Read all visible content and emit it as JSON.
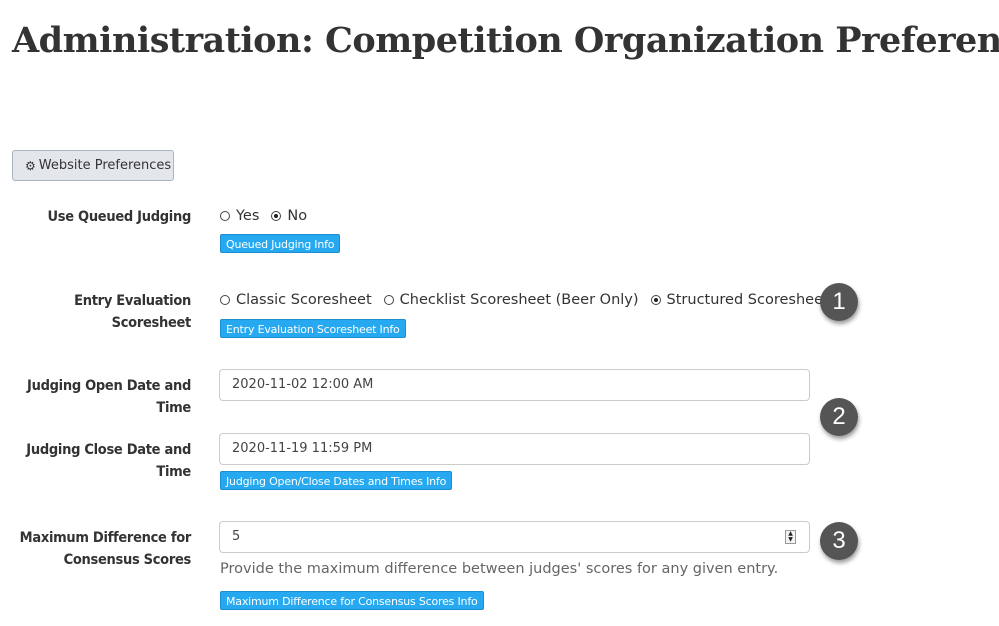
{
  "page": {
    "title": "Administration: Competition Organization Preferences"
  },
  "toolbar": {
    "website_prefs_label": "Website Preferences",
    "website_prefs_icon": "gear-icon"
  },
  "queued_judging": {
    "label": "Use Queued Judging",
    "options": [
      {
        "label": "Yes",
        "selected": false
      },
      {
        "label": "No",
        "selected": true
      }
    ],
    "info_label": "Queued Judging Info"
  },
  "scoresheet": {
    "label_line1": "Entry Evaluation",
    "label_line2": "Scoresheet",
    "options": [
      {
        "label": "Classic Scoresheet",
        "selected": false
      },
      {
        "label": "Checklist Scoresheet (Beer Only)",
        "selected": false
      },
      {
        "label": "Structured Scoresheet",
        "selected": true
      }
    ],
    "info_label": "Entry Evaluation Scoresheet Info"
  },
  "judging_open": {
    "label_line1": "Judging Open Date and",
    "label_line2": "Time",
    "value": "2020-11-02 12:00 AM"
  },
  "judging_close": {
    "label_line1": "Judging Close Date and",
    "label_line2": "Time",
    "value": "2020-11-19 11:59 PM",
    "info_label": "Judging Open/Close Dates and Times Info"
  },
  "consensus": {
    "label_line1": "Maximum Difference for",
    "label_line2": "Consensus Scores",
    "value": "5",
    "help_text": "Provide the maximum difference between judges' scores for any given entry.",
    "info_label": "Maximum Difference for Consensus Scores Info"
  },
  "callouts": [
    "1",
    "2",
    "3"
  ],
  "colors": {
    "info_button": "#27a9f1",
    "callout_badge": "#555555",
    "prefs_button_bg": "#e3e7ec"
  }
}
